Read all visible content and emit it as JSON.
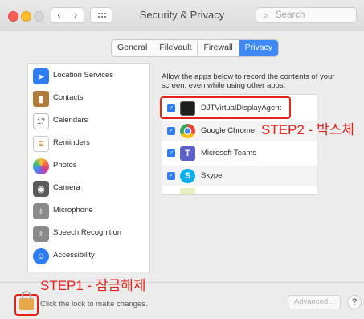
{
  "window": {
    "title": "Security & Privacy"
  },
  "titlebar": {
    "back_label": "‹",
    "forward_label": "›"
  },
  "search": {
    "placeholder": "Search",
    "icon": "magnifier-icon"
  },
  "tabs": [
    {
      "label": "General"
    },
    {
      "label": "FileVault"
    },
    {
      "label": "Firewall"
    },
    {
      "label": "Privacy",
      "selected": true
    }
  ],
  "sidebar": {
    "items": [
      {
        "label": "Location Services",
        "icon": "location-arrow-icon",
        "color": "#2e7cf6"
      },
      {
        "label": "Contacts",
        "icon": "contacts-book-icon",
        "color": "#b07a3a"
      },
      {
        "label": "Calendars",
        "icon": "calendar-icon",
        "day": "17"
      },
      {
        "label": "Reminders",
        "icon": "reminders-list-icon"
      },
      {
        "label": "Photos",
        "icon": "photos-flower-icon"
      },
      {
        "label": "Camera",
        "icon": "camera-icon"
      },
      {
        "label": "Microphone",
        "icon": "microphone-waveform-icon"
      },
      {
        "label": "Speech Recognition",
        "icon": "speech-waveform-icon"
      },
      {
        "label": "Accessibility",
        "icon": "accessibility-person-icon",
        "color": "#2e7cf6"
      }
    ]
  },
  "main": {
    "description": "Allow the apps below to record the contents of your screen, even while using other apps.",
    "apps": [
      {
        "label": "DJTVirtualDisplayAgent",
        "checked": true,
        "icon": "terminal-app-icon"
      },
      {
        "label": "Google Chrome",
        "checked": true,
        "icon": "chrome-icon"
      },
      {
        "label": "Microsoft Teams",
        "checked": true,
        "icon": "teams-icon"
      },
      {
        "label": "Skype",
        "checked": true,
        "icon": "skype-icon"
      }
    ]
  },
  "annotations": {
    "step1": "STEP1 - 잠금해제",
    "step2": "STEP2 - 박스체",
    "color": "#e2231a"
  },
  "footer": {
    "lock_message": "Click the lock to make changes.",
    "advanced_label": "Advanced...",
    "help_label": "?"
  }
}
